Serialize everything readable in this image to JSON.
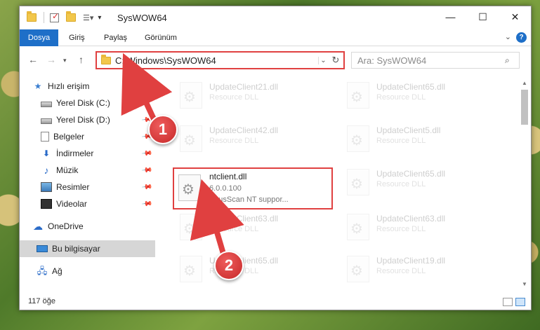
{
  "window": {
    "title": "SysWOW64"
  },
  "ribbon": {
    "tabs": [
      "Dosya",
      "Giriş",
      "Paylaş",
      "Görünüm"
    ],
    "help": "?"
  },
  "nav": {
    "address": "C:\\Windows\\SysWOW64",
    "search_placeholder": "Ara: SysWOW64"
  },
  "sidebar": {
    "items": [
      {
        "label": "Hızlı erişim",
        "icon": "star-icon",
        "pinned": false
      },
      {
        "label": "Yerel Disk (C:)",
        "icon": "drive-icon",
        "pinned": false
      },
      {
        "label": "Yerel Disk (D:)",
        "icon": "drive-icon",
        "pinned": true
      },
      {
        "label": "Belgeler",
        "icon": "documents-icon",
        "pinned": true
      },
      {
        "label": "İndirmeler",
        "icon": "downloads-icon",
        "pinned": true
      },
      {
        "label": "Müzik",
        "icon": "music-icon",
        "pinned": true
      },
      {
        "label": "Resimler",
        "icon": "pictures-icon",
        "pinned": true
      },
      {
        "label": "Videolar",
        "icon": "videos-icon",
        "pinned": true
      },
      {
        "label": "OneDrive",
        "icon": "cloud-icon",
        "pinned": false
      },
      {
        "label": "Bu bilgisayar",
        "icon": "computer-icon",
        "pinned": false
      },
      {
        "label": "Ağ",
        "icon": "network-icon",
        "pinned": false
      }
    ]
  },
  "files": {
    "faded": [
      {
        "name": "UpdateClient21.dll",
        "type": "Resource DLL"
      },
      {
        "name": "UpdateClient65.dll",
        "type": "Resource DLL"
      },
      {
        "name": "UpdateClient42.dll",
        "type": "Resource DLL"
      },
      {
        "name": "UpdateClient5.dll",
        "type": "Resource DLL"
      },
      {
        "name": "UpdateClient65.dll",
        "type": "Resource DLL"
      },
      {
        "name": "UpdateClient63.dll",
        "type": "Resource DLL"
      },
      {
        "name": "UpdateClient63.dll",
        "type": "Resource DLL"
      },
      {
        "name": "UpdateClient65.dll",
        "type": "Resource DLL"
      },
      {
        "name": "UpdateClient19.dll",
        "type": "Resource DLL"
      }
    ],
    "highlighted": {
      "name": "ntclient.dll",
      "version": "6.0.0.100",
      "description": "VirusScan NT suppor..."
    }
  },
  "status": {
    "count": "117 öğe"
  },
  "callouts": {
    "one": "1",
    "two": "2"
  },
  "colors": {
    "accent": "#1e6fc8",
    "highlight": "#e04040"
  }
}
